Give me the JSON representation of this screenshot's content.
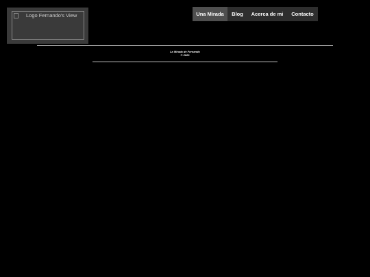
{
  "header": {
    "logo_alt": "Logo Fernando's View"
  },
  "nav": {
    "items": [
      {
        "label": "Una Mirada",
        "active": true
      },
      {
        "label": "Blog",
        "active": false
      },
      {
        "label": "Acerca de mi",
        "active": false
      },
      {
        "label": "Contacto",
        "active": false
      }
    ]
  },
  "footer": {
    "title": "La Mirada de Fernando",
    "copyright": "© 2020"
  },
  "colors": {
    "background": "#000000",
    "nav_background": "#2e2e2e",
    "nav_active": "#4f4f4f",
    "logo_panel": "#3a3a3a"
  }
}
